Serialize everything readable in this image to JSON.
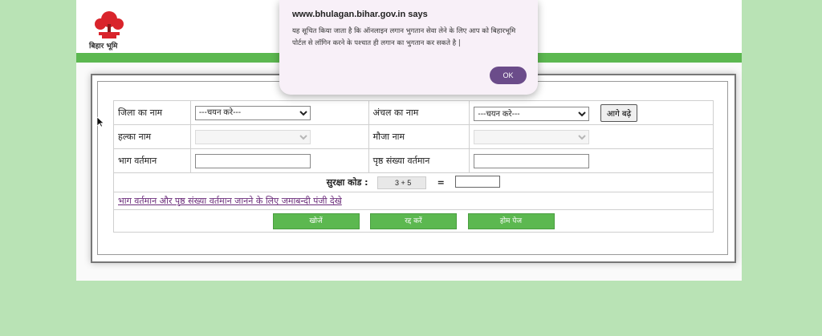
{
  "header": {
    "logo_text": "बिहार भूमि"
  },
  "form": {
    "district_label": "जिला का नाम",
    "district_select": "---चयन करे---",
    "circle_label": "अंचल का नाम",
    "circle_select": "---चयन करे---",
    "go_button": "आगे बढ़े",
    "halka_label": "हल्का नाम",
    "mauza_label": "मौजा नाम",
    "bhag_label": "भाग वर्तमान",
    "page_label": "पृष्ठ संख्या वर्तमान",
    "captcha_label": "सुरक्षा कोड :",
    "captcha_value": "3 + 5",
    "captcha_eq": "=",
    "jamabandi_link": "भाग वर्तमान और पृष्ठ संख्या वर्तमान जानने के लिए जमाबन्दी पंजी देखे",
    "search_button": "खोजें",
    "cancel_button": "रद्द करें",
    "home_button": "होम पेज"
  },
  "dialog": {
    "title": "www.bhulagan.bihar.gov.in says",
    "message": "यह सूचित किया जाता है कि ऑनलाइन लगान भुगतान सेवा लेने के लिए आप को बिहारभूमि पोर्टल से लॉगिन करने के पश्चात ही लगान का भुगतान कर सकते है |",
    "ok_label": "OK"
  },
  "colors": {
    "background": "#b9e3b5",
    "accent_green": "#5cb850",
    "dialog_button": "#6b4c8a"
  }
}
